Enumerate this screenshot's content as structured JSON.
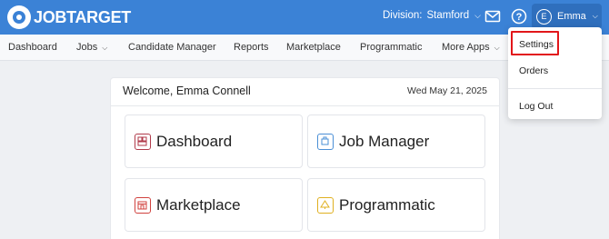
{
  "header": {
    "logo_text": "JOBTARGET",
    "division_label": "Division:",
    "division_value": "Stamford",
    "user_initial": "E",
    "user_name": "Emma"
  },
  "nav": {
    "items": [
      {
        "label": "Dashboard",
        "has_caret": false
      },
      {
        "label": "Jobs",
        "has_caret": true
      },
      {
        "label": "Candidate Manager",
        "has_caret": false
      },
      {
        "label": "Reports",
        "has_caret": false
      },
      {
        "label": "Marketplace",
        "has_caret": false
      },
      {
        "label": "Programmatic",
        "has_caret": false
      },
      {
        "label": "More Apps",
        "has_caret": true
      }
    ]
  },
  "card": {
    "welcome": "Welcome, Emma Connell",
    "date": "Wed May 21, 2025",
    "tiles": [
      {
        "label": "Dashboard",
        "color": "#b03a4a"
      },
      {
        "label": "Job Manager",
        "color": "#4a8fd6"
      },
      {
        "label": "Marketplace",
        "color": "#d0413e"
      },
      {
        "label": "Programmatic",
        "color": "#e0b020"
      }
    ]
  },
  "dropdown": {
    "items": [
      "Settings",
      "Orders",
      "Log Out"
    ]
  },
  "colors": {
    "header_bg": "#3b82d6",
    "highlight": "#e2161a"
  }
}
